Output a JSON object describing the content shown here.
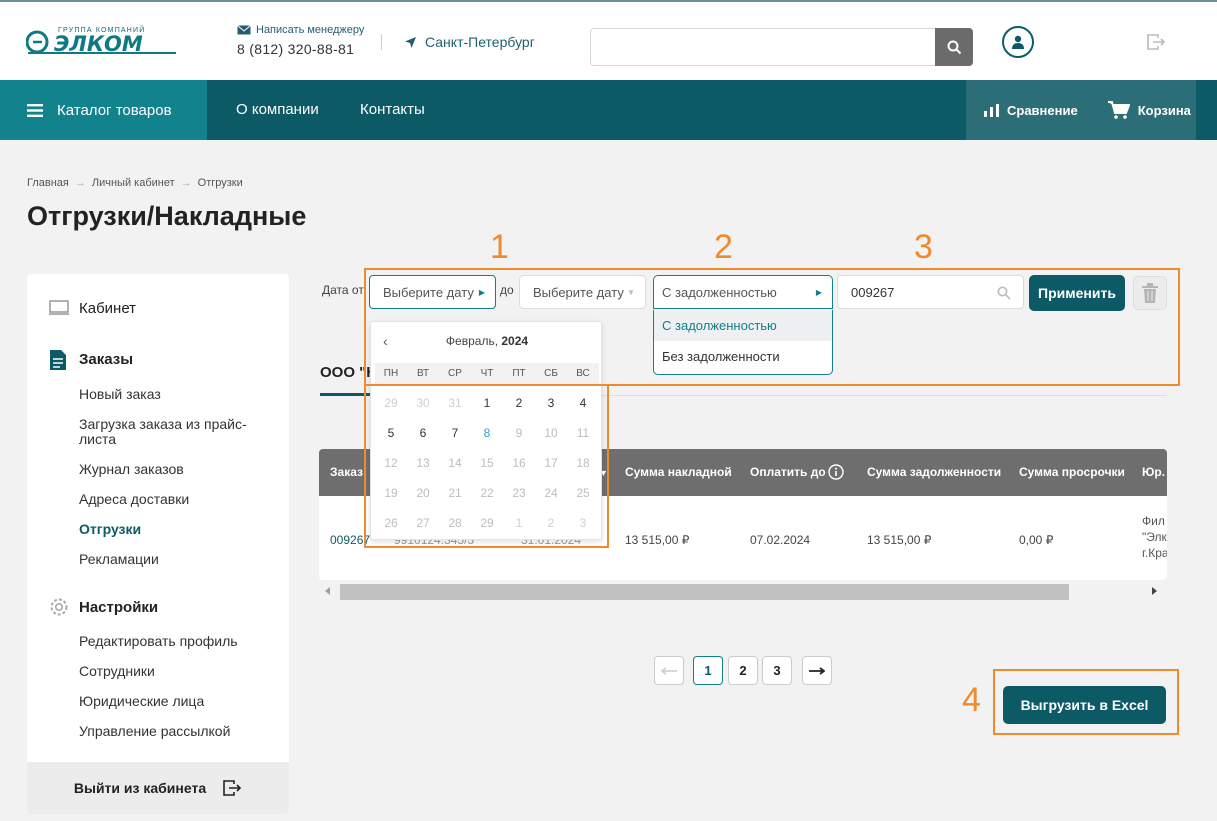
{
  "header": {
    "logo_sub": "ГРУППА КОМПАНИЙ",
    "logo_text": "ЭЛКОМ",
    "mail_label": "Написать менеджеру",
    "phone": "8 (812) 320-88-81",
    "city": "Санкт-Петербург",
    "search_value": ""
  },
  "nav": {
    "catalog": "Каталог товаров",
    "links": [
      "О компании",
      "Контакты"
    ],
    "compare": "Сравнение",
    "cart": "Корзина"
  },
  "breadcrumb": [
    "Главная",
    "Личный кабинет",
    "Отгрузки"
  ],
  "page_title": "Отгрузки/Накладные",
  "sidebar": {
    "cabinet": "Кабинет",
    "orders_title": "Заказы",
    "orders_items": [
      "Новый заказ",
      "Загрузка заказа из прайс-листа",
      "Журнал заказов",
      "Адреса доставки",
      "Отгрузки",
      "Рекламации"
    ],
    "settings_title": "Настройки",
    "settings_items": [
      "Редактировать профиль",
      "Сотрудники",
      "Юридические лица",
      "Управление рассылкой"
    ],
    "logout": "Выйти из кабинета"
  },
  "filters": {
    "date_from_label": "Дата от",
    "date_to_label": "до",
    "date_from_placeholder": "Выберите дату",
    "date_to_placeholder": "Выберите дату",
    "debt_selected": "С задолженностью",
    "debt_options": [
      "С задолженностью",
      "Без задолженности"
    ],
    "order_number": "009267",
    "apply": "Применить"
  },
  "calendar": {
    "month": "Февраль,",
    "year": "2024",
    "weekdays": [
      "ПН",
      "ВТ",
      "СР",
      "ЧТ",
      "ПТ",
      "СБ",
      "ВС"
    ],
    "days": [
      [
        "29",
        "30",
        "31",
        "1",
        "2",
        "3",
        "4"
      ],
      [
        "5",
        "6",
        "7",
        "8",
        "9",
        "10",
        "11"
      ],
      [
        "12",
        "13",
        "14",
        "15",
        "16",
        "17",
        "18"
      ],
      [
        "19",
        "20",
        "21",
        "22",
        "23",
        "24",
        "25"
      ],
      [
        "26",
        "27",
        "28",
        "29",
        "1",
        "2",
        "3"
      ]
    ]
  },
  "tab": "ООО \"Ку",
  "table": {
    "headers": [
      "Заказ",
      "Сумма накладной",
      "Оплатить до",
      "Сумма задолженности",
      "Сумма просрочки",
      "Юр."
    ],
    "row": {
      "order": "009267",
      "col2": "9910124.345/3",
      "col3": "31.01.2024",
      "invoice_sum": "13 515,00 ₽",
      "pay_until": "07.02.2024",
      "debt_sum": "13 515,00 ₽",
      "overdue_sum": "0,00 ₽",
      "legal": [
        "Фил",
        "\"Элк",
        "г.Кра"
      ]
    }
  },
  "pagination": [
    "1",
    "2",
    "3"
  ],
  "excel_button": "Выгрузить в Excel",
  "annotations": [
    "1",
    "2",
    "3",
    "4"
  ],
  "colors": {
    "primary": "#0d5a67",
    "accent": "#12828c",
    "annotation": "#ef8a2e"
  }
}
